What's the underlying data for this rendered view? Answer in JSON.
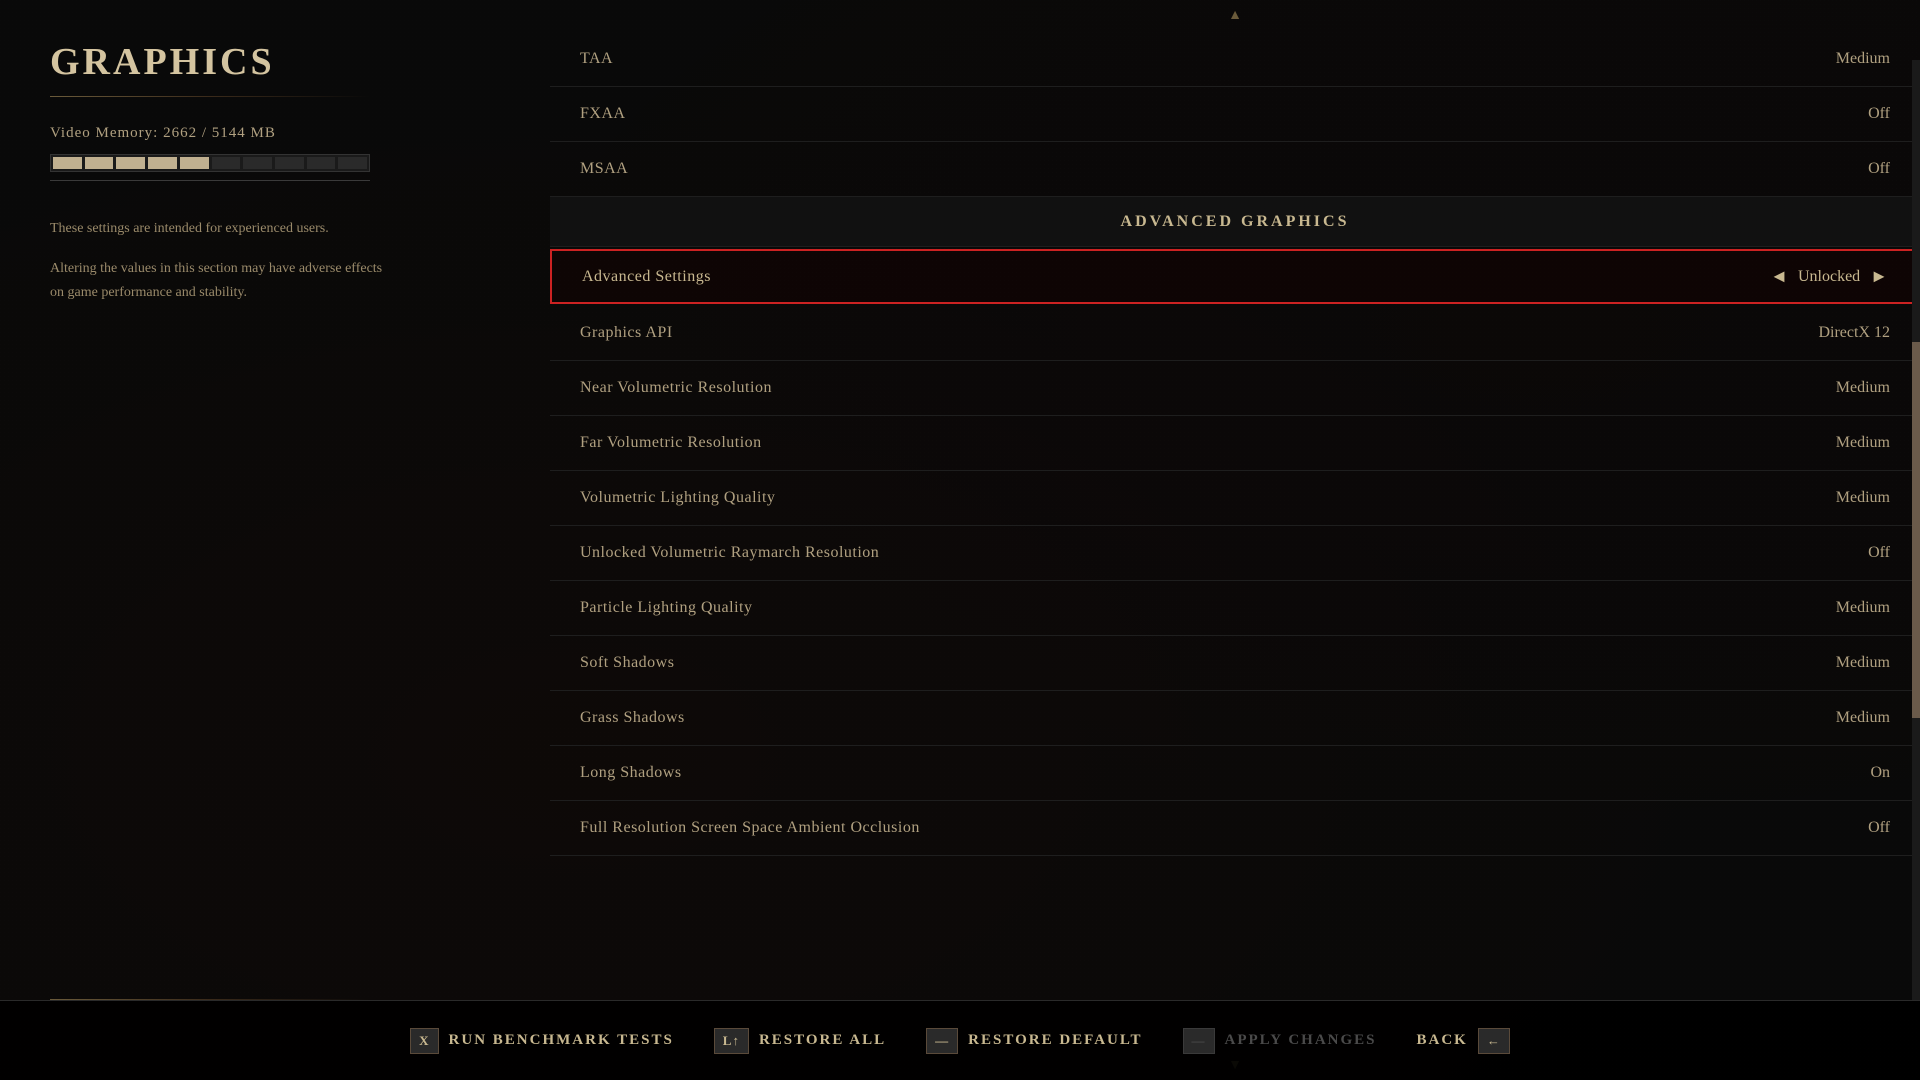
{
  "page": {
    "title": "Graphics",
    "left_panel": {
      "video_memory_label": "Video Memory:  2662  /  5144  MB",
      "warning_text_1": "These settings are intended for experienced users.",
      "warning_text_2": "Altering the values in this section may have adverse effects on game performance and stability.",
      "memory_filled_segments": 5,
      "memory_total_segments": 10
    },
    "settings": {
      "section_above": "Advanced Graphics",
      "rows": [
        {
          "name": "TAA",
          "value": "Medium"
        },
        {
          "name": "FXAA",
          "value": "Off"
        },
        {
          "name": "MSAA",
          "value": "Off"
        }
      ],
      "section_header": "Advanced Graphics",
      "advanced_rows": [
        {
          "name": "Advanced Settings",
          "value": "Unlocked",
          "selected": true
        },
        {
          "name": "Graphics API",
          "value": "DirectX 12"
        },
        {
          "name": "Near Volumetric Resolution",
          "value": "Medium"
        },
        {
          "name": "Far Volumetric Resolution",
          "value": "Medium"
        },
        {
          "name": "Volumetric Lighting Quality",
          "value": "Medium"
        },
        {
          "name": "Unlocked Volumetric Raymarch Resolution",
          "value": "Off"
        },
        {
          "name": "Particle Lighting Quality",
          "value": "Medium"
        },
        {
          "name": "Soft Shadows",
          "value": "Medium"
        },
        {
          "name": "Grass Shadows",
          "value": "Medium"
        },
        {
          "name": "Long Shadows",
          "value": "On"
        },
        {
          "name": "Full Resolution Screen Space Ambient Occlusion",
          "value": "Off"
        }
      ]
    },
    "toolbar": {
      "items": [
        {
          "key": "X",
          "label": "Run Benchmark Tests",
          "active": true
        },
        {
          "key": "L↑",
          "label": "Restore All",
          "active": true
        },
        {
          "key": "—",
          "label": "Restore Default",
          "active": true
        },
        {
          "key": "—",
          "label": "Apply Changes",
          "active": false
        },
        {
          "key": "←",
          "label": "Back",
          "active": true
        }
      ]
    }
  }
}
